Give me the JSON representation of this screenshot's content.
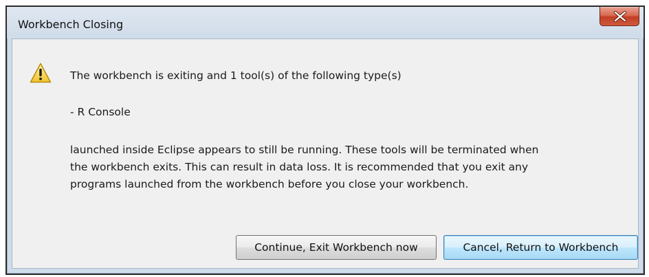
{
  "window": {
    "title": "Workbench Closing",
    "close_icon": "close-icon"
  },
  "message": {
    "icon": "warning-icon",
    "line1": "The workbench is exiting and 1 tool(s) of the following type(s)",
    "line2": "- R Console",
    "paragraph": [
      "launched inside Eclipse appears to still be running. These tools will be terminated when",
      "the workbench exits. This can result in data loss. It is recommended that you exit any",
      "programs launched from the workbench before you close your workbench."
    ]
  },
  "buttons": {
    "continue_label": "Continue, Exit Workbench now",
    "cancel_label": "Cancel, Return to Workbench"
  },
  "colors": {
    "close_button": "#c94a30",
    "default_button_border": "#3c7fb1",
    "window_frame": "#cfdcea"
  }
}
